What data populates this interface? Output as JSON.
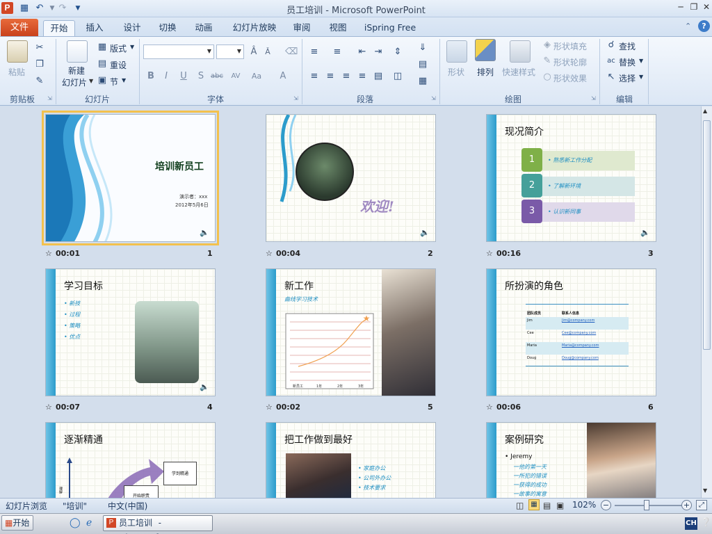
{
  "window": {
    "title": "员工培训 - Microsoft PowerPoint",
    "app_icon": "P"
  },
  "tabs": {
    "file": "文件",
    "items": [
      "开始",
      "插入",
      "设计",
      "切换",
      "动画",
      "幻灯片放映",
      "审阅",
      "视图",
      "iSpring Free"
    ],
    "active_index": 0
  },
  "ribbon": {
    "clipboard": {
      "paste": "粘贴",
      "label": "剪贴板"
    },
    "slides": {
      "new_slide_1": "新建",
      "new_slide_2": "幻灯片",
      "layout": "版式",
      "reset": "重设",
      "section": "节",
      "label": "幻灯片"
    },
    "font": {
      "label": "字体",
      "font_name": "",
      "font_size": ""
    },
    "paragraph": {
      "label": "段落"
    },
    "drawing": {
      "shape": "形状",
      "arrange": "排列",
      "quick_styles": "快速样式",
      "shape_fill": "形状填充",
      "shape_outline": "形状轮廓",
      "shape_effects": "形状效果",
      "label": "绘图"
    },
    "editing": {
      "find": "查找",
      "replace": "替换",
      "select": "选择",
      "label": "编辑"
    }
  },
  "slides": [
    {
      "num": "1",
      "time": "00:01",
      "title": "培训新员工",
      "presenter": "演示者：xxx",
      "date": "2012年5月6日"
    },
    {
      "num": "2",
      "time": "00:04",
      "title": "欢迎!"
    },
    {
      "num": "3",
      "time": "00:16",
      "title": "现况简介",
      "items": [
        "熟悉新工作分配",
        "了解新环境",
        "认识新同事"
      ],
      "steps": [
        "1",
        "2",
        "3"
      ]
    },
    {
      "num": "4",
      "time": "00:07",
      "title": "学习目标",
      "bullets": [
        "新技",
        "过程",
        "策略",
        "优点"
      ]
    },
    {
      "num": "5",
      "time": "00:02",
      "title": "新工作",
      "subtitle": "曲线学习技术",
      "chart_labels": [
        "新员工",
        "1年",
        "2年",
        "3年"
      ]
    },
    {
      "num": "6",
      "time": "00:06",
      "title": "所扮演的角色",
      "table_headers": [
        "团队成员",
        "联系人信息"
      ],
      "table_rows": [
        [
          "Jim",
          "Jim@company.com"
        ],
        [
          "Cee",
          "Cee@company.com"
        ],
        [
          "Maria",
          "Maria@company.com"
        ],
        [
          "Doug",
          "Doug@company.com"
        ]
      ]
    },
    {
      "num": "7",
      "time": "",
      "title": "逐渐精通",
      "box1": "学到精通",
      "box2": "开始职责",
      "axis": "理解"
    },
    {
      "num": "8",
      "time": "",
      "title": "把工作做到最好",
      "bullets": [
        "家庭办公",
        "公司外办公",
        "技术要求"
      ]
    },
    {
      "num": "9",
      "time": "",
      "title": "案例研究",
      "lines": [
        "Jeremy",
        "一他的第一天",
        "一所犯的错误",
        "一获得的成功",
        "一故事的寓意"
      ]
    }
  ],
  "statusbar": {
    "view": "幻灯片浏览",
    "theme": "\"培训\"",
    "language": "中文(中国)",
    "zoom": "102%"
  },
  "taskbar": {
    "start": "开始",
    "task": "员工培训 - Microsof...",
    "ime": "CH"
  }
}
